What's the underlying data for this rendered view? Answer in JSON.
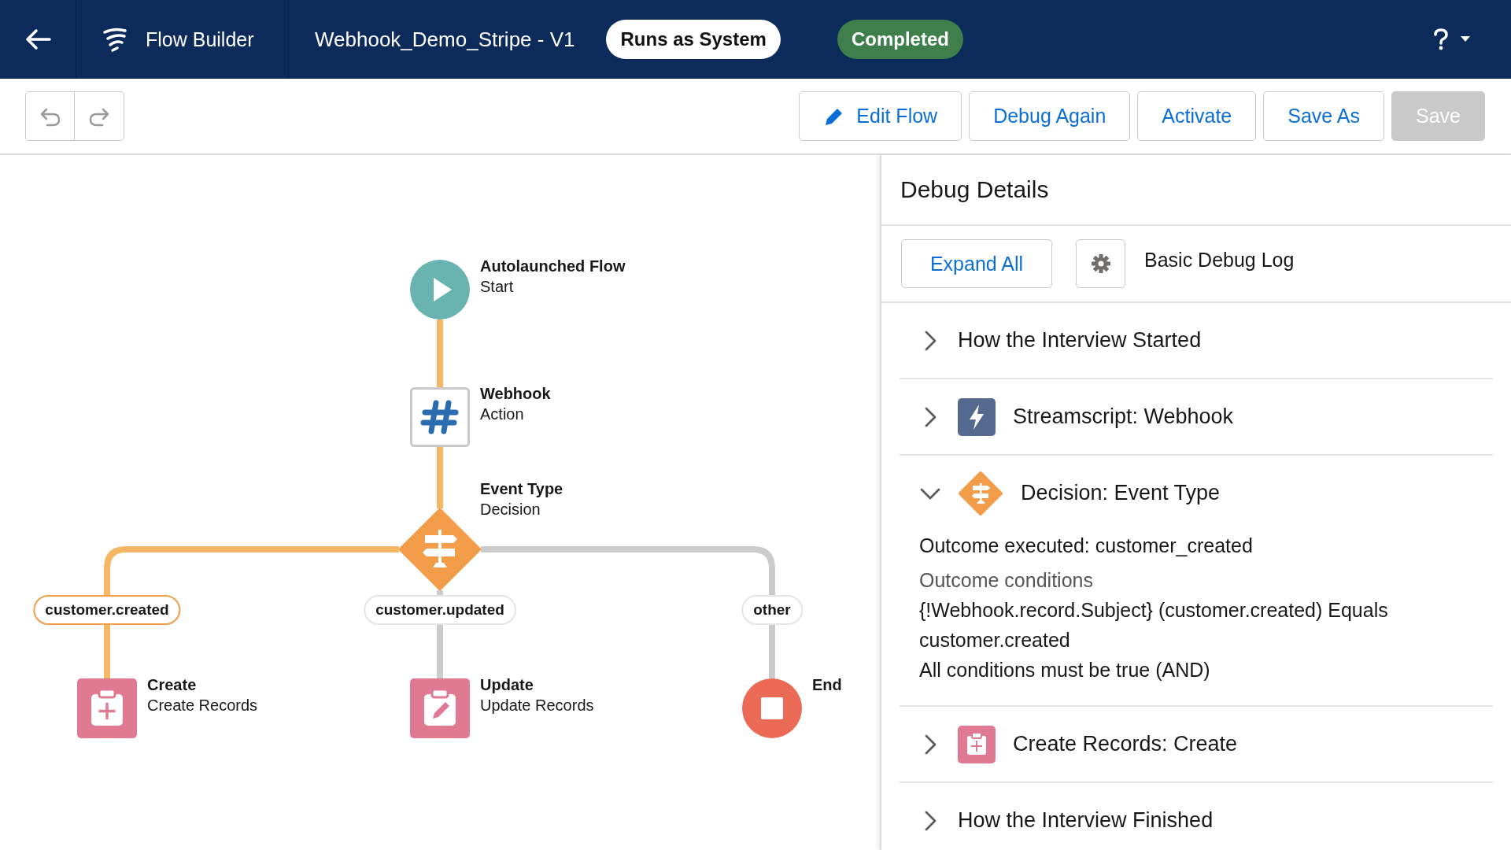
{
  "header": {
    "app_name": "Flow Builder",
    "flow_title": "Webhook_Demo_Stripe - V1",
    "run_mode": "Runs as System",
    "status": "Completed"
  },
  "toolbar": {
    "buttons": [
      {
        "label": "Edit Flow",
        "kind": "edit",
        "disabled": false
      },
      {
        "label": "Debug Again",
        "kind": "plain",
        "disabled": false
      },
      {
        "label": "Activate",
        "kind": "plain",
        "disabled": false
      },
      {
        "label": "Save As",
        "kind": "plain",
        "disabled": false
      },
      {
        "label": "Save",
        "kind": "plain",
        "disabled": true
      }
    ]
  },
  "canvas": {
    "nodes": [
      {
        "kind": "start",
        "title": "Autolaunched Flow",
        "subtitle": "Start"
      },
      {
        "kind": "action",
        "title": "Webhook",
        "subtitle": "Action"
      },
      {
        "kind": "decision",
        "title": "Event Type",
        "subtitle": "Decision"
      }
    ],
    "outcomes": [
      {
        "label": "customer.created",
        "executed": true,
        "target": {
          "kind": "create",
          "title": "Create",
          "subtitle": "Create Records"
        }
      },
      {
        "label": "customer.updated",
        "executed": false,
        "target": {
          "kind": "update",
          "title": "Update",
          "subtitle": "Update Records"
        }
      },
      {
        "label": "other",
        "executed": false,
        "target": {
          "kind": "end",
          "title": "End"
        }
      }
    ]
  },
  "debug_panel": {
    "title": "Debug Details",
    "expand_button": "Expand All",
    "log_level": "Basic Debug Log",
    "sections": [
      {
        "kind": "start",
        "title": "How the Interview Started",
        "expanded": false
      },
      {
        "kind": "streamscript",
        "title": "Streamscript: Webhook",
        "expanded": false
      },
      {
        "kind": "decision",
        "title": "Decision: Event Type",
        "expanded": true,
        "details": [
          {
            "kind": "result",
            "text": "Outcome executed: customer_created"
          },
          {
            "kind": "heading",
            "text": "Outcome conditions"
          },
          {
            "kind": "condition",
            "text": "{!Webhook.record.Subject} (customer.created) Equals customer.created"
          },
          {
            "kind": "condition",
            "text": "All conditions must be true (AND)"
          }
        ]
      },
      {
        "kind": "create",
        "title": "Create Records: Create",
        "expanded": false
      },
      {
        "kind": "finish",
        "title": "How the Interview Finished",
        "expanded": false
      }
    ]
  }
}
